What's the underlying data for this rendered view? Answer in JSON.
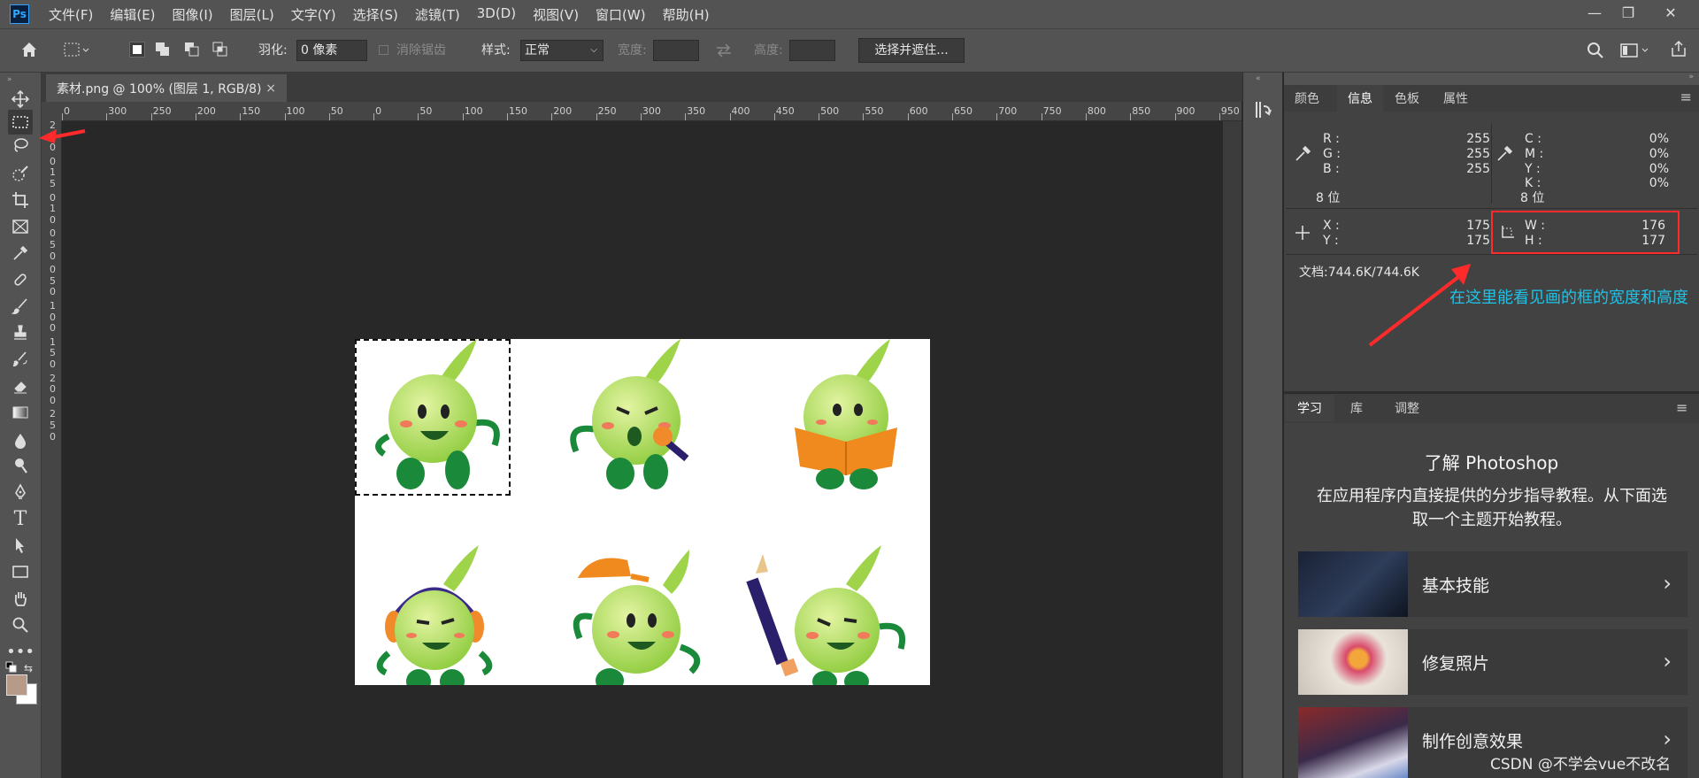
{
  "app": {
    "logo": "Ps"
  },
  "menu": [
    "文件(F)",
    "编辑(E)",
    "图像(I)",
    "图层(L)",
    "文字(Y)",
    "选择(S)",
    "滤镜(T)",
    "3D(D)",
    "视图(V)",
    "窗口(W)",
    "帮助(H)"
  ],
  "window_controls": {
    "minimize": "—",
    "restore": "❐",
    "close": "✕"
  },
  "options": {
    "feather_label": "羽化:",
    "feather_value": "0 像素",
    "antialias_label": "消除锯齿",
    "style_label": "样式:",
    "style_value": "正常",
    "width_label": "宽度:",
    "height_label": "高度:",
    "select_mask_button": "选择并遮住..."
  },
  "document_tab": {
    "title": "素材.png @ 100% (图层 1, RGB/8)",
    "close": "×"
  },
  "ruler": {
    "h_ticks": [
      "0",
      "300",
      "250",
      "200",
      "150",
      "100",
      "50",
      "0",
      "50",
      "100",
      "150",
      "200",
      "250",
      "300",
      "350",
      "400",
      "450",
      "500",
      "550",
      "600",
      "650",
      "700",
      "750",
      "800",
      "850",
      "900",
      "950"
    ],
    "v_ticks": [
      "2",
      "0",
      "0",
      "0",
      "1",
      "5",
      "0",
      "1",
      "0",
      "0",
      "5",
      "0",
      "0",
      "5",
      "0",
      "1",
      "0",
      "0",
      "1",
      "5",
      "0",
      "2",
      "0",
      "0",
      "2",
      "5",
      "0"
    ]
  },
  "info_panel": {
    "tabs": [
      "颜色",
      "信息",
      "色板",
      "属性"
    ],
    "active_tab": "信息",
    "rgb": [
      {
        "label": "R :",
        "value": "255"
      },
      {
        "label": "G :",
        "value": "255"
      },
      {
        "label": "B :",
        "value": "255"
      }
    ],
    "rgb_bits": "8 位",
    "cmyk": [
      {
        "label": "C :",
        "value": "0%"
      },
      {
        "label": "M :",
        "value": "0%"
      },
      {
        "label": "Y :",
        "value": "0%"
      },
      {
        "label": "K :",
        "value": "0%"
      }
    ],
    "cmyk_bits": "8 位",
    "xy": [
      {
        "label": "X :",
        "value": "175"
      },
      {
        "label": "Y :",
        "value": "175"
      }
    ],
    "wh": [
      {
        "label": "W :",
        "value": "176"
      },
      {
        "label": "H :",
        "value": "177"
      }
    ],
    "doc_size": "文档:744.6K/744.6K"
  },
  "annotation": "在这里能看见画的框的宽度和高度",
  "learn_panel": {
    "tabs": [
      "学习",
      "库",
      "调整"
    ],
    "active_tab": "学习",
    "heading": "了解 Photoshop",
    "description": "在应用程序内直接提供的分步指导教程。从下面选取一个主题开始教程。",
    "cards": [
      {
        "title": "基本技能"
      },
      {
        "title": "修复照片"
      },
      {
        "title": "制作创意效果"
      }
    ]
  },
  "watermark": "CSDN @不学会vue不改名",
  "colors": {
    "accent_red": "#ff2a2a",
    "annotation": "#1ec3e8",
    "panel_bg": "#535353",
    "canvas_bg": "#282828"
  }
}
